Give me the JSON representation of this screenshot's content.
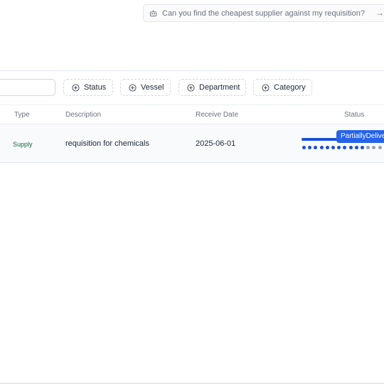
{
  "assistant": {
    "icon": "bot-icon",
    "placeholder": "Can you find the cheapest supplier against my requisition?",
    "submit_icon": "arrow-right-icon"
  },
  "filters": {
    "search_value": "",
    "buttons": [
      {
        "label": "Status",
        "icon": "plus-circle-icon"
      },
      {
        "label": "Vessel",
        "icon": "plus-circle-icon"
      },
      {
        "label": "Department",
        "icon": "plus-circle-icon"
      },
      {
        "label": "Category",
        "icon": "plus-circle-icon"
      }
    ]
  },
  "table": {
    "columns": [
      "Type",
      "Description",
      "Receive Date",
      "Status"
    ],
    "rows": [
      {
        "type": "Supply",
        "description": "requisition for chemicals",
        "receive_date": "2025-06-01",
        "status": "PartiallyDelivered",
        "progress_steps_completed": 11,
        "progress_steps_total": 14
      }
    ]
  },
  "colors": {
    "accent": "#2563eb",
    "progress_done": "#1e4fd0",
    "progress_pending": "#9ca3af",
    "type_text": "#166534"
  }
}
